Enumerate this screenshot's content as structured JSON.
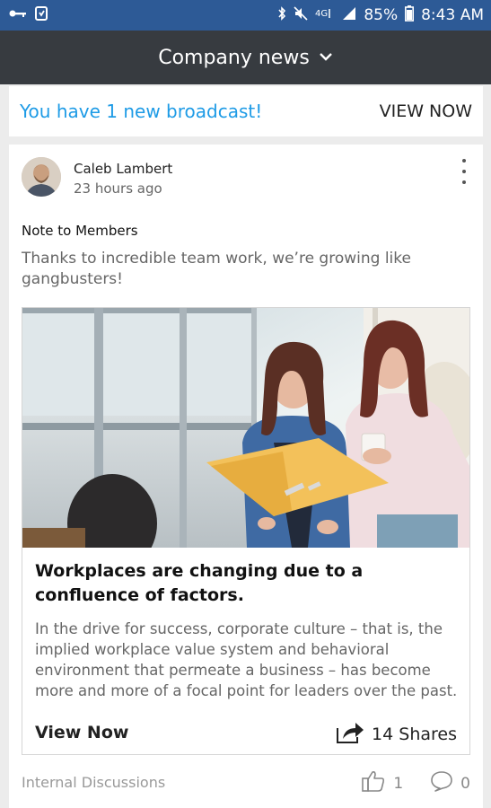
{
  "status_bar": {
    "battery": "85%",
    "time": "8:43 AM",
    "icons": [
      "key-icon",
      "alarm-icon",
      "bluetooth-icon",
      "mute-icon",
      "4g-icon",
      "signal-icon",
      "battery-icon"
    ]
  },
  "app_bar": {
    "title": "Company news",
    "dropdown_icon": "chevron-down-icon"
  },
  "banner": {
    "text": "You have 1 new broadcast!",
    "action": "VIEW NOW"
  },
  "post": {
    "author": "Caleb Lambert",
    "time_ago": "23 hours ago",
    "title": "Note to Members",
    "body": "Thanks to incredible team work, we’re growing like gangbusters!",
    "link": {
      "image": "two-women-reviewing-yellow-folder-photo",
      "title": "Workplaces are changing due to a confluence of factors.",
      "description": "In the drive for success, corporate culture – that is, the implied workplace value system and behavioral environment that permeate a business – has become more and more of a focal point for leaders over the past.",
      "cta": "View Now",
      "shares": "14 Shares"
    },
    "channel": "Internal Discussions",
    "likes": "1",
    "comments": "0"
  },
  "colors": {
    "status_bar": "#2d5a96",
    "app_bar": "#373b40",
    "accent": "#1e9be6",
    "background": "#ececec"
  }
}
